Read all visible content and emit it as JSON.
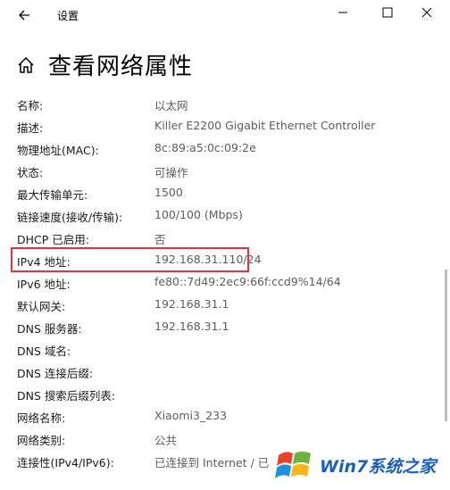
{
  "window": {
    "title": "设置",
    "back_icon": "arrow-left-icon",
    "minimize_label": "—",
    "maximize_label": "☐",
    "close_label": "✕"
  },
  "page": {
    "title": "查看网络属性",
    "home_icon": "home-icon"
  },
  "properties": [
    {
      "label": "名称:",
      "value": "以太网"
    },
    {
      "label": "描述:",
      "value": "Killer E2200 Gigabit Ethernet Controller"
    },
    {
      "label": "物理地址(MAC):",
      "value": "8c:89:a5:0c:09:2e"
    },
    {
      "label": "状态:",
      "value": "可操作"
    },
    {
      "label": "最大传输单元:",
      "value": "1500"
    },
    {
      "label": "链接速度(接收/传输):",
      "value": "100/100 (Mbps)"
    },
    {
      "label": "DHCP 已启用:",
      "value": "否"
    },
    {
      "label": "IPv4 地址:",
      "value": "192.168.31.110/24"
    },
    {
      "label": "IPv6 地址:",
      "value": "fe80::7d49:2ec9:66f:ccd9%14/64"
    },
    {
      "label": "默认网关:",
      "value": "192.168.31.1"
    },
    {
      "label": "DNS 服务器:",
      "value": "192.168.31.1"
    },
    {
      "label": "DNS 域名:",
      "value": ""
    },
    {
      "label": "DNS 连接后缀:",
      "value": ""
    },
    {
      "label": "DNS 搜索后缀列表:",
      "value": ""
    },
    {
      "label": "网络名称:",
      "value": "Xiaomi3_233"
    },
    {
      "label": "网络类别:",
      "value": "公共"
    },
    {
      "label": "连接性(IPv4/IPv6):",
      "value": "已连接到 Internet / 已"
    }
  ],
  "highlight_color": "#d9363e",
  "watermark": {
    "text": "Win7系统之家",
    "site": "Www.Winwin7.com"
  }
}
